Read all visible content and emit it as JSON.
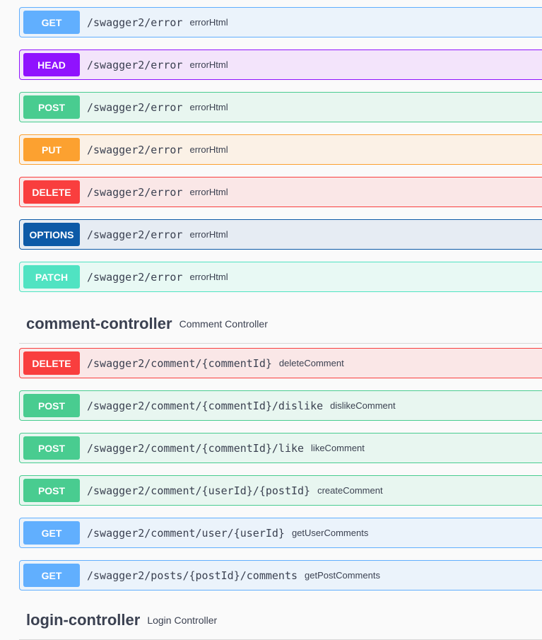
{
  "ops_error": [
    {
      "method": "GET",
      "path": "/swagger2/error",
      "summary": "errorHtml",
      "bg": "#ebf3fb",
      "border": "#61affe",
      "badge": "#61affe"
    },
    {
      "method": "HEAD",
      "path": "/swagger2/error",
      "summary": "errorHtml",
      "bg": "#f3e4fb",
      "border": "#9012fe",
      "badge": "#9012fe"
    },
    {
      "method": "POST",
      "path": "/swagger2/error",
      "summary": "errorHtml",
      "bg": "#e8f6f0",
      "border": "#49cc90",
      "badge": "#49cc90"
    },
    {
      "method": "PUT",
      "path": "/swagger2/error",
      "summary": "errorHtml",
      "bg": "#fbf1e6",
      "border": "#fca130",
      "badge": "#fca130"
    },
    {
      "method": "DELETE",
      "path": "/swagger2/error",
      "summary": "errorHtml",
      "bg": "#fae7e7",
      "border": "#f93e3e",
      "badge": "#f93e3e"
    },
    {
      "method": "OPTIONS",
      "path": "/swagger2/error",
      "summary": "errorHtml",
      "bg": "#e6ecf3",
      "border": "#0d5aa7",
      "badge": "#0d5aa7"
    },
    {
      "method": "PATCH",
      "path": "/swagger2/error",
      "summary": "errorHtml",
      "bg": "#e8f9f4",
      "border": "#50e3c2",
      "badge": "#50e3c2"
    }
  ],
  "comment_tag": {
    "name": "comment-controller",
    "description": "Comment Controller"
  },
  "ops_comment": [
    {
      "method": "DELETE",
      "path": "/swagger2/comment/{commentId}",
      "summary": "deleteComment",
      "bg": "#fae7e7",
      "border": "#f93e3e",
      "badge": "#f93e3e"
    },
    {
      "method": "POST",
      "path": "/swagger2/comment/{commentId}/dislike",
      "summary": "dislikeComment",
      "bg": "#e8f6f0",
      "border": "#49cc90",
      "badge": "#49cc90"
    },
    {
      "method": "POST",
      "path": "/swagger2/comment/{commentId}/like",
      "summary": "likeComment",
      "bg": "#e8f6f0",
      "border": "#49cc90",
      "badge": "#49cc90"
    },
    {
      "method": "POST",
      "path": "/swagger2/comment/{userId}/{postId}",
      "summary": "createComment",
      "bg": "#e8f6f0",
      "border": "#49cc90",
      "badge": "#49cc90"
    },
    {
      "method": "GET",
      "path": "/swagger2/comment/user/{userId}",
      "summary": "getUserComments",
      "bg": "#ebf3fb",
      "border": "#61affe",
      "badge": "#61affe"
    },
    {
      "method": "GET",
      "path": "/swagger2/posts/{postId}/comments",
      "summary": "getPostComments",
      "bg": "#ebf3fb",
      "border": "#61affe",
      "badge": "#61affe"
    }
  ],
  "login_tag": {
    "name": "login-controller",
    "description": "Login Controller"
  }
}
